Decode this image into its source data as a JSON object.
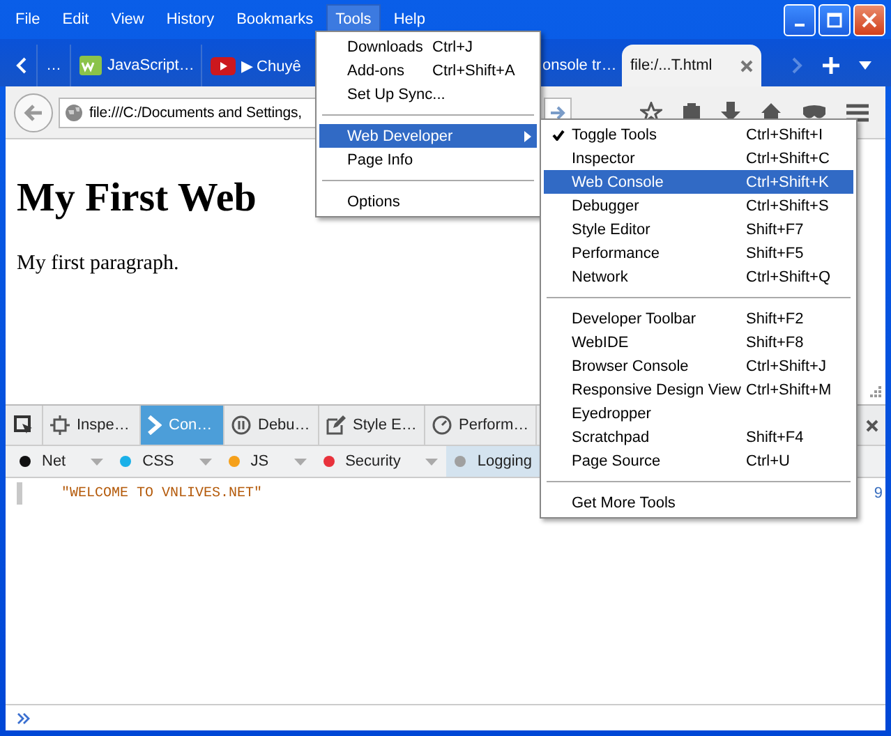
{
  "menu_bar": [
    {
      "label": "File",
      "selected": false
    },
    {
      "label": "Edit",
      "selected": false
    },
    {
      "label": "View",
      "selected": false
    },
    {
      "label": "History",
      "selected": false
    },
    {
      "label": "Bookmarks",
      "selected": false
    },
    {
      "label": "Tools",
      "selected": true
    },
    {
      "label": "Help",
      "selected": false
    }
  ],
  "tabs": [
    {
      "label": "…",
      "selected": false
    },
    {
      "label": "JavaScript…",
      "selected": false
    },
    {
      "label": "▶ Chuyê",
      "selected": false
    },
    {
      "label": "onsole tr…",
      "selected": false
    },
    {
      "label": "file:/...T.html",
      "selected": true
    }
  ],
  "address_bar": {
    "value": "file:///C:/Documents and Settings,"
  },
  "page": {
    "heading": "My First Web",
    "paragraph": "My first paragraph."
  },
  "devtools_tabs": [
    {
      "label": "Inspe…",
      "selected": false
    },
    {
      "label": "Con…",
      "selected": true
    },
    {
      "label": "Debu…",
      "selected": false
    },
    {
      "label": "Style E…",
      "selected": false
    },
    {
      "label": "Perform…",
      "selected": false
    }
  ],
  "console_filters": [
    {
      "label": "Net",
      "color": "#111111",
      "selected": false
    },
    {
      "label": "CSS",
      "color": "#1ab0e8",
      "selected": false
    },
    {
      "label": "JS",
      "color": "#f5a01a",
      "selected": false
    },
    {
      "label": "Security",
      "color": "#e8323c",
      "selected": false
    },
    {
      "label": "Logging",
      "color": "#a0a0a0",
      "selected": true
    }
  ],
  "console_messages": [
    {
      "text": "\"WELCOME TO VNLIVES.NET\"",
      "source": "9"
    }
  ],
  "tools_menu": [
    {
      "kind": "item",
      "label": "Downloads",
      "shortcut": "Ctrl+J",
      "selected": false
    },
    {
      "kind": "item",
      "label": "Add-ons",
      "shortcut": "Ctrl+Shift+A",
      "selected": false
    },
    {
      "kind": "item",
      "label": "Set Up Sync...",
      "selected": false
    },
    {
      "kind": "separator"
    },
    {
      "kind": "submenu",
      "label": "Web Developer",
      "selected": true
    },
    {
      "kind": "item",
      "label": "Page Info",
      "selected": false
    },
    {
      "kind": "separator"
    },
    {
      "kind": "item",
      "label": "Options",
      "selected": false
    }
  ],
  "web_developer_menu": [
    {
      "kind": "item",
      "label": "Toggle Tools",
      "shortcut": "Ctrl+Shift+I",
      "checked": true,
      "selected": false
    },
    {
      "kind": "item",
      "label": "Inspector",
      "shortcut": "Ctrl+Shift+C",
      "checked": false,
      "selected": false
    },
    {
      "kind": "item",
      "label": "Web Console",
      "shortcut": "Ctrl+Shift+K",
      "checked": false,
      "selected": true
    },
    {
      "kind": "item",
      "label": "Debugger",
      "shortcut": "Ctrl+Shift+S",
      "checked": false,
      "selected": false
    },
    {
      "kind": "item",
      "label": "Style Editor",
      "shortcut": "Shift+F7",
      "checked": false,
      "selected": false
    },
    {
      "kind": "item",
      "label": "Performance",
      "shortcut": "Shift+F5",
      "checked": false,
      "selected": false
    },
    {
      "kind": "item",
      "label": "Network",
      "shortcut": "Ctrl+Shift+Q",
      "checked": false,
      "selected": false
    },
    {
      "kind": "separator"
    },
    {
      "kind": "item",
      "label": "Developer Toolbar",
      "shortcut": "Shift+F2",
      "checked": false,
      "selected": false
    },
    {
      "kind": "item",
      "label": "WebIDE",
      "shortcut": "Shift+F8",
      "checked": false,
      "selected": false
    },
    {
      "kind": "item",
      "label": "Browser Console",
      "shortcut": "Ctrl+Shift+J",
      "checked": false,
      "selected": false
    },
    {
      "kind": "item",
      "label": "Responsive Design View",
      "shortcut": "Ctrl+Shift+M",
      "checked": false,
      "selected": false
    },
    {
      "kind": "item",
      "label": "Eyedropper",
      "checked": false,
      "selected": false
    },
    {
      "kind": "item",
      "label": "Scratchpad",
      "shortcut": "Shift+F4",
      "checked": false,
      "selected": false
    },
    {
      "kind": "item",
      "label": "Page Source",
      "shortcut": "Ctrl+U",
      "checked": false,
      "selected": false
    },
    {
      "kind": "separator"
    },
    {
      "kind": "item",
      "label": "Get More Tools",
      "checked": false,
      "selected": false
    }
  ]
}
